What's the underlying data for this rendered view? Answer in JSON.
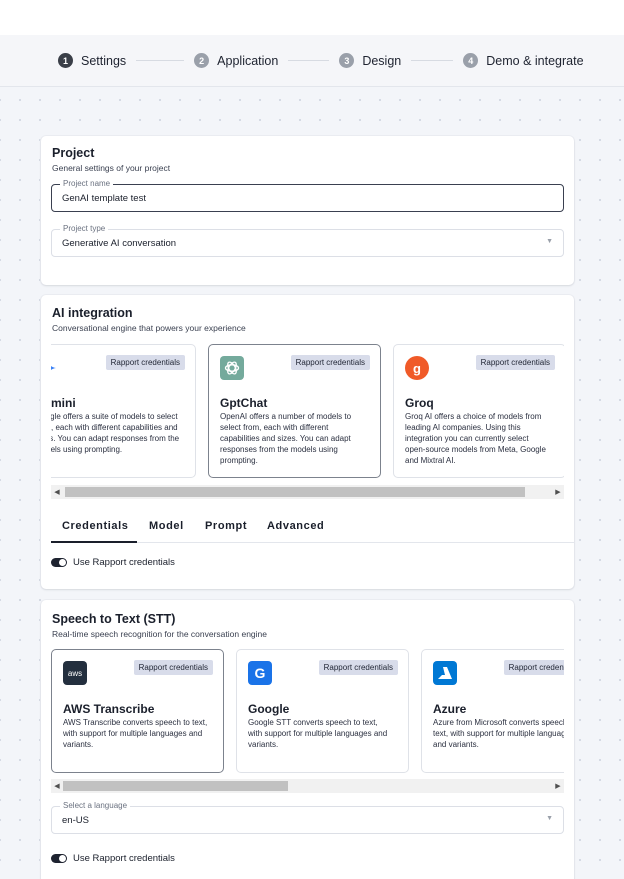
{
  "stepper": {
    "steps": [
      {
        "num": "1",
        "label": "Settings"
      },
      {
        "num": "2",
        "label": "Application"
      },
      {
        "num": "3",
        "label": "Design"
      },
      {
        "num": "4",
        "label": "Demo & integrate"
      }
    ]
  },
  "project": {
    "title": "Project",
    "subtitle": "General settings of your project",
    "name_label": "Project name",
    "name_value": "GenAI template test",
    "type_label": "Project type",
    "type_value": "Generative AI conversation"
  },
  "ai": {
    "title": "AI integration",
    "subtitle": "Conversational engine that powers your experience",
    "providers": [
      {
        "name": "Gemini",
        "badge": "Rapport credentials",
        "desc": "Google offers a suite of models to select from, each with different capabilities and sizes. You can adapt responses from the models using prompting.",
        "icon": "gemini-icon"
      },
      {
        "name": "GptChat",
        "badge": "Rapport credentials",
        "desc": "OpenAI offers a number of models to select from, each with different capabilities and sizes. You can adapt responses from the models using prompting.",
        "icon": "openai-icon"
      },
      {
        "name": "Groq",
        "badge": "Rapport credentials",
        "desc": "Groq AI offers a choice of models from leading AI companies. Using this integration you can currently select open-source models from Meta, Google and Mixtral AI.",
        "icon": "groq-icon"
      }
    ],
    "scroll_position": 0.08,
    "scroll_visible_fraction": 0.94,
    "tabs": [
      "Credentials",
      "Model",
      "Prompt",
      "Advanced"
    ],
    "toggle_label": "Use Rapport credentials"
  },
  "stt": {
    "title": "Speech to Text (STT)",
    "subtitle": "Real-time speech recognition for the conversation engine",
    "providers": [
      {
        "name": "AWS Transcribe",
        "badge": "Rapport credentials",
        "desc": "AWS Transcribe converts speech to text, with support for multiple languages and variants.",
        "icon": "aws-icon"
      },
      {
        "name": "Google",
        "badge": "Rapport credentials",
        "desc": "Google STT converts speech to text, with support for multiple languages and variants.",
        "icon": "google-icon"
      },
      {
        "name": "Azure",
        "badge": "Rapport credentials",
        "desc": "Azure from Microsoft converts speech to text, with support for multiple languages and variants.",
        "icon": "azure-icon"
      }
    ],
    "scroll_position": 0.0,
    "scroll_visible_fraction": 0.46,
    "language_label": "Select a language",
    "language_value": "en-US",
    "toggle_label": "Use Rapport credentials"
  },
  "colors": {
    "accent_dark": "#1e2330",
    "badge_bg": "#d8dcea",
    "groq_orange": "#f05a28",
    "openai_green": "#74aa9c",
    "google_blue": "#1a73e8",
    "azure_blue": "#0078d4",
    "aws_dark": "#232f3e"
  }
}
